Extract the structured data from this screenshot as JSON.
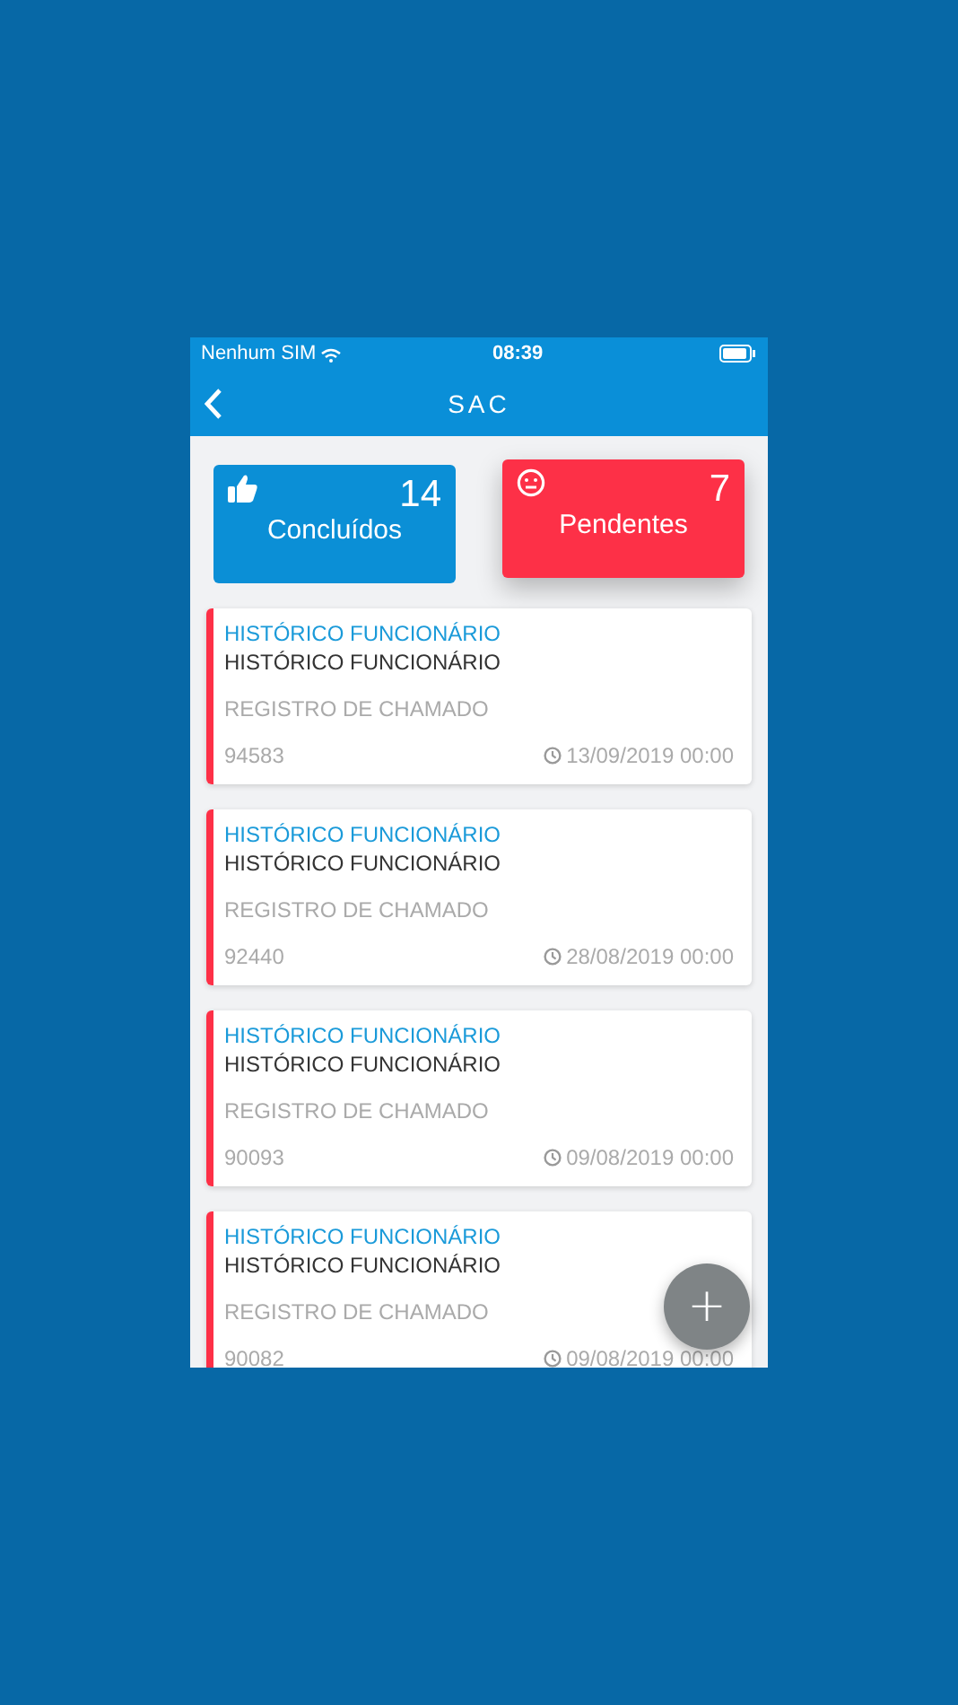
{
  "status_bar": {
    "carrier": "Nenhum SIM",
    "time": "08:39"
  },
  "nav": {
    "title": "SAC"
  },
  "summary": [
    {
      "kind": "thumbs",
      "count": "14",
      "label": "Concluídos",
      "color": "#0b8fd6",
      "selected": false
    },
    {
      "kind": "face",
      "count": "7",
      "label": "Pendentes",
      "color": "#fd3047",
      "selected": true
    }
  ],
  "tickets": [
    {
      "category": "HISTÓRICO FUNCIONÁRIO",
      "title": "HISTÓRICO FUNCIONÁRIO",
      "type": "REGISTRO DE CHAMADO",
      "number": "94583",
      "date": "13/09/2019 00:00",
      "color": "#fd3047"
    },
    {
      "category": "HISTÓRICO FUNCIONÁRIO",
      "title": "HISTÓRICO FUNCIONÁRIO",
      "type": "REGISTRO DE CHAMADO",
      "number": "92440",
      "date": "28/08/2019 00:00",
      "color": "#fd3047"
    },
    {
      "category": "HISTÓRICO FUNCIONÁRIO",
      "title": "HISTÓRICO FUNCIONÁRIO",
      "type": "REGISTRO DE CHAMADO",
      "number": "90093",
      "date": "09/08/2019 00:00",
      "color": "#fd3047"
    },
    {
      "category": "HISTÓRICO FUNCIONÁRIO",
      "title": "HISTÓRICO FUNCIONÁRIO",
      "type": "REGISTRO DE CHAMADO",
      "number": "90082",
      "date": "09/08/2019 00:00",
      "color": "#fd3047"
    }
  ],
  "fab": {
    "symbol": "+"
  }
}
